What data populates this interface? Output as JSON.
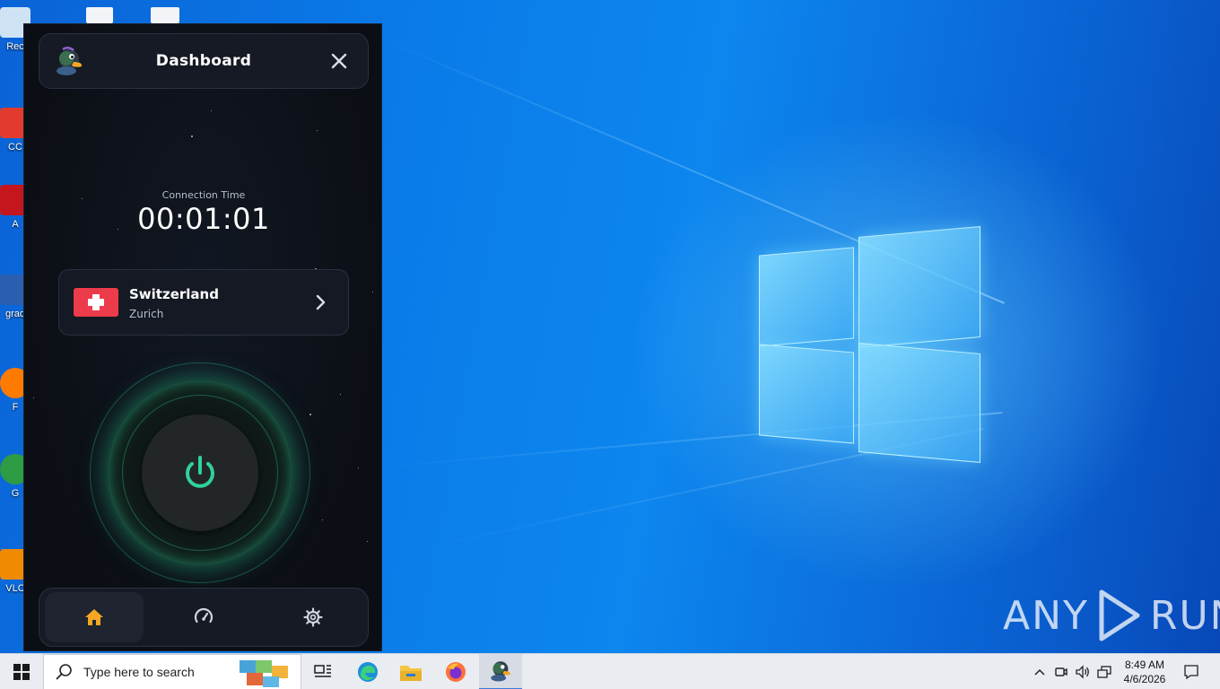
{
  "desktop": {
    "icons": [
      {
        "label": "Rec",
        "color": "#cfe3f5"
      },
      {
        "label": "CC",
        "color": "#e23b2e"
      },
      {
        "label": "A",
        "color": "#c4161c"
      },
      {
        "label": "grad",
        "color": "#2a5fb0"
      },
      {
        "label": "F",
        "color": "#ff7b00"
      },
      {
        "label": "G",
        "color": "#2e9b45"
      },
      {
        "label": "VLC",
        "color": "#f08a00"
      }
    ],
    "watermark": {
      "left": "ANY",
      "right": "RUN"
    }
  },
  "app": {
    "title": "Dashboard",
    "connection_label": "Connection Time",
    "connection_time": "00:01:01",
    "server": {
      "country": "Switzerland",
      "city": "Zurich",
      "flag_color": "#ec3b4b"
    },
    "accent_color": "#2fd39a",
    "nav": {
      "active": "home",
      "home_color": "#f5a623",
      "icon_color": "#cfd4dc"
    }
  },
  "taskbar": {
    "search_placeholder": "Type here to search",
    "apps": [
      "task-view",
      "edge",
      "file-explorer",
      "firefox",
      "vpn-duck"
    ],
    "clock_time": "8:49 AM",
    "clock_date": "4/6/2026"
  }
}
